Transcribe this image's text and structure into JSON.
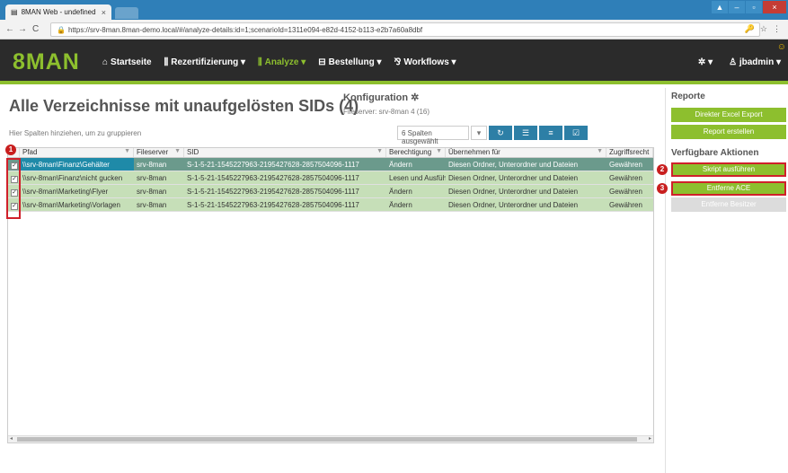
{
  "browser": {
    "tab_title": "8MAN Web - undefined",
    "tab_close": "×",
    "url": "https://srv-8man.8man-demo.local/#/analyze-details:id=1;scenarioId=1311e094-e82d-4152-b113-e2b7a60a8dbf",
    "back": "←",
    "forward": "→",
    "reload": "C",
    "lock": "🔒",
    "key_icon": "🔑",
    "star_icon": "☆",
    "menu_icon": "⋮",
    "window": {
      "minimize": "–",
      "restore": "▫",
      "close": "×",
      "profile": "▲"
    }
  },
  "navbar": {
    "logo": "8MAN",
    "items": [
      {
        "icon": "⌂",
        "label": "Startseite"
      },
      {
        "icon": "⫼",
        "label": "Rezertifizierung ▾"
      },
      {
        "icon": "⫼",
        "label": "Analyze ▾"
      },
      {
        "icon": "⊟",
        "label": "Bestellung ▾"
      },
      {
        "icon": "⅋",
        "label": "Workflows ▾"
      }
    ],
    "settings": "✲ ▾",
    "user": "♙ jbadmin ▾",
    "smiley": "☺"
  },
  "page": {
    "title": "Alle Verzeichnisse mit unaufgelösten SIDs (4)",
    "config_title": "Konfiguration ✲",
    "config_sub": "Fileserver: srv-8man 4 (16)",
    "group_hint": "Hier Spalten hinziehen, um zu gruppieren",
    "columns_select": "6 Spalten ausgewählt",
    "columns_caret": "▾",
    "toolbar": [
      "↻",
      "☰",
      "≡",
      "☑"
    ]
  },
  "grid": {
    "headers": [
      "Pfad",
      "Fileserver",
      "SID",
      "Berechtigung",
      "Übernehmen für",
      "Zugriffsrecht"
    ],
    "filter_icon": "▼",
    "rows": [
      {
        "check": "✓",
        "path": "\\\\srv-8man\\Finanz\\Gehälter",
        "server": "srv-8man",
        "sid": "S-1-5-21-1545227963-2195427628-2857504096-1117",
        "perm": "Ändern",
        "applies": "Diesen Ordner, Unterordner und Dateien",
        "right": "Gewähren"
      },
      {
        "check": "✓",
        "path": "\\\\srv-8man\\Finanz\\nicht gucken",
        "server": "srv-8man",
        "sid": "S-1-5-21-1545227963-2195427628-2857504096-1117",
        "perm": "Lesen und Ausführen",
        "applies": "Diesen Ordner, Unterordner und Dateien",
        "right": "Gewähren"
      },
      {
        "check": "✓",
        "path": "\\\\srv-8man\\Marketing\\Flyer",
        "server": "srv-8man",
        "sid": "S-1-5-21-1545227963-2195427628-2857504096-1117",
        "perm": "Ändern",
        "applies": "Diesen Ordner, Unterordner und Dateien",
        "right": "Gewähren"
      },
      {
        "check": "✓",
        "path": "\\\\srv-8man\\Marketing\\Vorlagen",
        "server": "srv-8man",
        "sid": "S-1-5-21-1545227963-2195427628-2857504096-1117",
        "perm": "Ändern",
        "applies": "Diesen Ordner, Unterordner und Dateien",
        "right": "Gewähren"
      }
    ],
    "scroll_left": "◂",
    "scroll_right": "▸"
  },
  "sidebar": {
    "reports_title": "Reporte",
    "excel_export": "Direkter Excel Export",
    "create_report": "Report erstellen",
    "actions_title": "Verfügbare Aktionen",
    "run_script": "Skript ausführen",
    "remove_ace": "Entferne ACE",
    "remove_owner": "Entferne Besitzer"
  },
  "markers": [
    "1",
    "2",
    "3"
  ],
  "colors": {
    "accent": "#8dbf2e",
    "navbar": "#2b2b2b",
    "toolbar_button": "#2d7fa6",
    "row": "#c6dfb8",
    "highlight": "#d0202a"
  }
}
